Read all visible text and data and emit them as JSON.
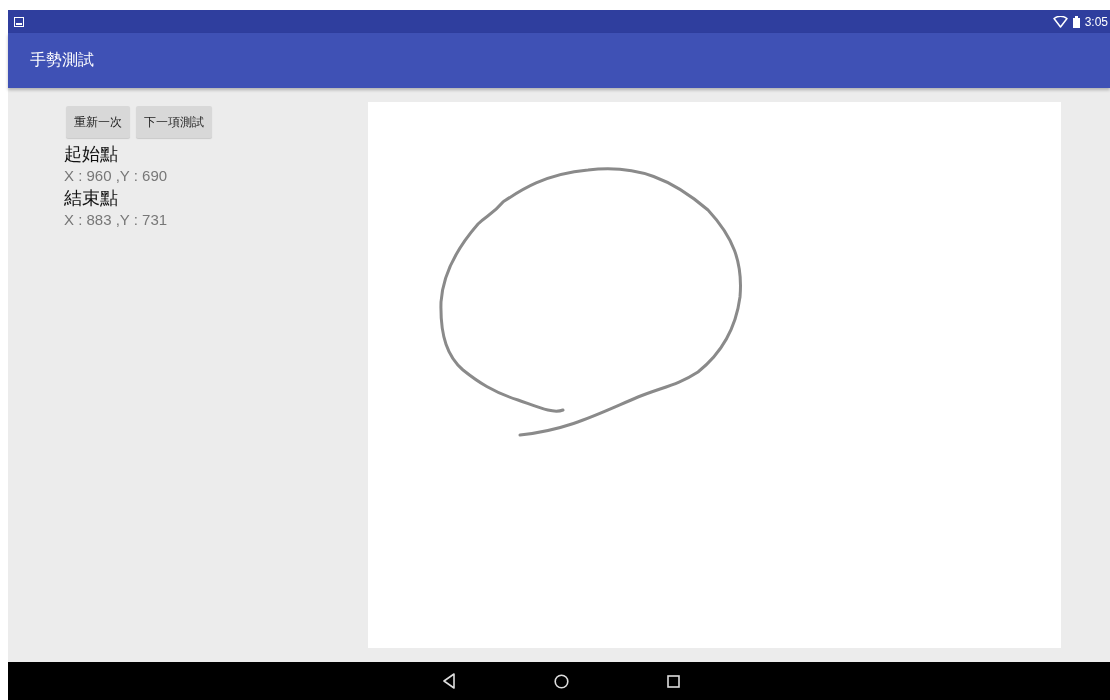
{
  "status_bar": {
    "time": "3:05"
  },
  "app_bar": {
    "title": "手勢測試"
  },
  "buttons": [
    "重新一次",
    "下一項測試"
  ],
  "points": [
    {
      "label": "起始點",
      "coords": "X : 960 ,Y : 690"
    },
    {
      "label": "結束點",
      "coords": "X : 883 ,Y : 731"
    }
  ]
}
